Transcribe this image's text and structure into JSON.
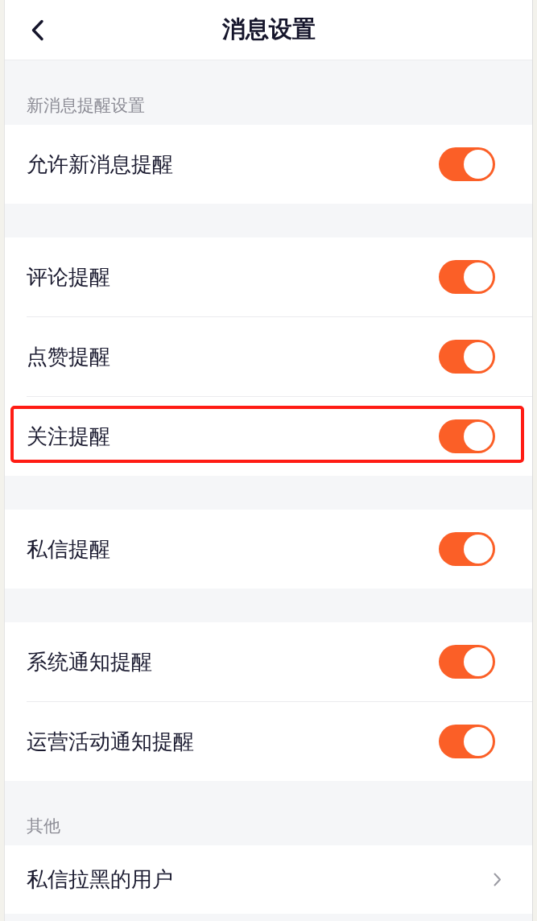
{
  "header": {
    "title": "消息设置"
  },
  "blocks": [
    {
      "heading": "新消息提醒设置",
      "rows": [
        {
          "kind": "toggle",
          "label": "允许新消息提醒",
          "on": true,
          "highlighted": false
        }
      ]
    },
    {
      "rows": [
        {
          "kind": "toggle",
          "label": "评论提醒",
          "on": true,
          "highlighted": false
        },
        {
          "kind": "toggle",
          "label": "点赞提醒",
          "on": true,
          "highlighted": false
        },
        {
          "kind": "toggle",
          "label": "关注提醒",
          "on": true,
          "highlighted": true
        }
      ]
    },
    {
      "rows": [
        {
          "kind": "toggle",
          "label": "私信提醒",
          "on": true,
          "highlighted": false
        }
      ]
    },
    {
      "rows": [
        {
          "kind": "toggle",
          "label": "系统通知提醒",
          "on": true,
          "highlighted": false
        },
        {
          "kind": "toggle",
          "label": "运营活动通知提醒",
          "on": true,
          "highlighted": false
        }
      ]
    },
    {
      "heading": "其他",
      "rows": [
        {
          "kind": "link",
          "label": "私信拉黑的用户",
          "highlighted": false
        }
      ]
    }
  ]
}
